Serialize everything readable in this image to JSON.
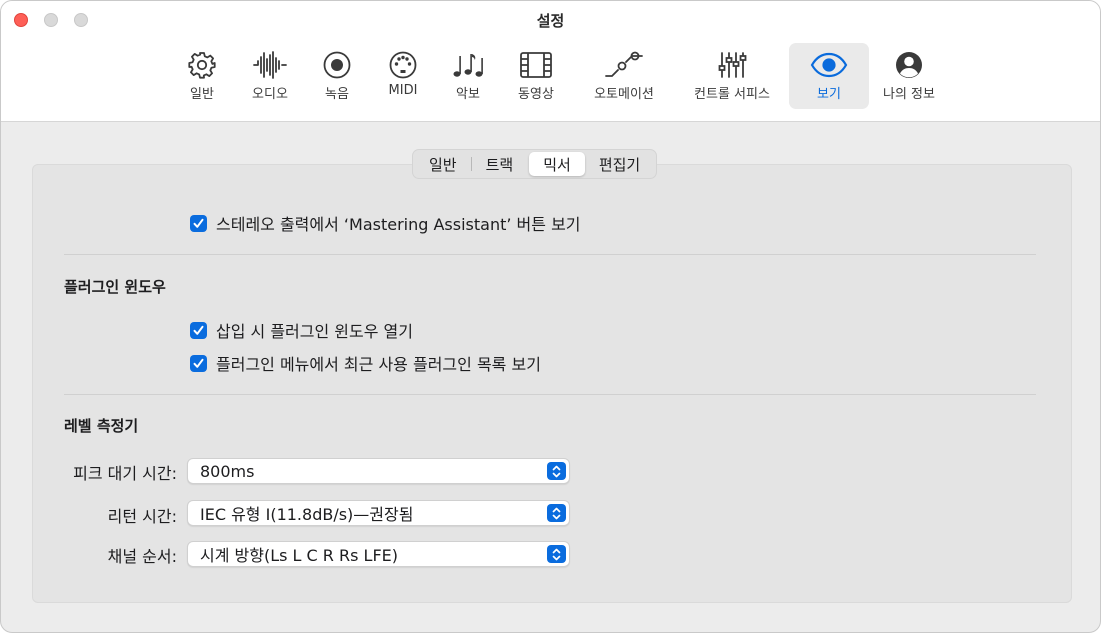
{
  "window": {
    "title": "설정"
  },
  "toolbar": {
    "items": [
      {
        "label": "일반",
        "icon": "gear-icon"
      },
      {
        "label": "오디오",
        "icon": "waveform-icon"
      },
      {
        "label": "녹음",
        "icon": "record-icon"
      },
      {
        "label": "MIDI",
        "icon": "midi-port-icon"
      },
      {
        "label": "악보",
        "icon": "music-notes-icon"
      },
      {
        "label": "동영상",
        "icon": "film-icon"
      },
      {
        "label": "오토메이션",
        "icon": "automation-curve-icon"
      },
      {
        "label": "컨트롤 서피스",
        "icon": "sliders-icon"
      },
      {
        "label": "보기",
        "icon": "eye-icon",
        "selected": true
      },
      {
        "label": "나의 정보",
        "icon": "person-circle-icon"
      }
    ]
  },
  "tabs": [
    {
      "label": "일반"
    },
    {
      "label": "트랙"
    },
    {
      "label": "믹서",
      "active": true
    },
    {
      "label": "편집기"
    }
  ],
  "mixer": {
    "mastering_assistant": {
      "label": "스테레오 출력에서 ‘Mastering Assistant’ 버튼 보기",
      "checked": true
    }
  },
  "plugin_window": {
    "title": "플러그인 윈도우",
    "open_on_insert": {
      "label": "삽입 시 플러그인 윈도우 열기",
      "checked": true
    },
    "recent_list": {
      "label": "플러그인 메뉴에서 최근 사용 플러그인 목록 보기",
      "checked": true
    }
  },
  "level_meter": {
    "title": "레벨 측정기",
    "peak_hold": {
      "label": "피크 대기 시간:",
      "value": "800ms"
    },
    "return_time": {
      "label": "리턴 시간:",
      "value": "IEC 유형 I(11.8dB/s)—권장됨"
    },
    "channel_order": {
      "label": "채널 순서:",
      "value": "시계 방향(Ls L C R Rs LFE)"
    }
  },
  "colors": {
    "accent": "#0a6cde",
    "close": "#fe5f57",
    "selected_tab_text": "#0a6bdc"
  }
}
